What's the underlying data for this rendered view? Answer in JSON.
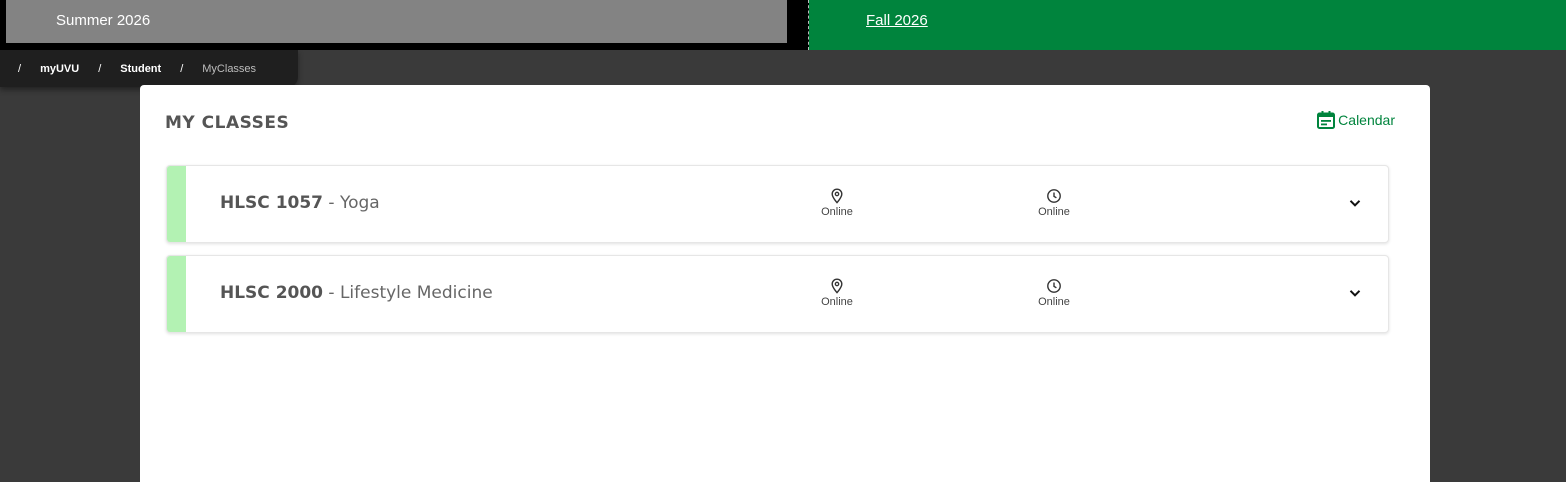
{
  "semesters": {
    "summer": "Summer 2026",
    "fall": "Fall 2026"
  },
  "breadcrumb": {
    "separator": "/",
    "items": [
      "myUVU",
      "Student"
    ],
    "current": "MyClasses"
  },
  "panel": {
    "title": "MY CLASSES",
    "calendar_label": "Calendar"
  },
  "classes": [
    {
      "code": "HLSC 1057",
      "name": " - Yoga",
      "location": "Online",
      "time": "Online"
    },
    {
      "code": "HLSC 2000",
      "name": " - Lifestyle Medicine",
      "location": "Online",
      "time": "Online"
    }
  ],
  "colors": {
    "brand_green": "#00843d",
    "accent_light_green": "#b3f2b3",
    "summer_tab": "#838383"
  },
  "icons": {
    "calendar": "calendar-icon",
    "location": "location-pin-icon",
    "time": "clock-icon",
    "expand": "chevron-down-icon"
  }
}
